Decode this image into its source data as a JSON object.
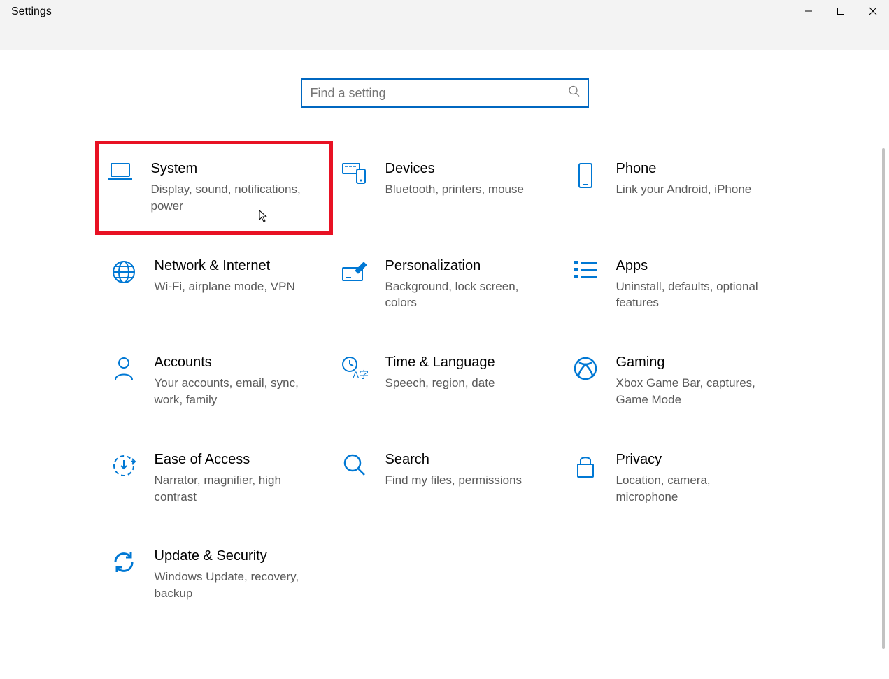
{
  "window": {
    "title": "Settings"
  },
  "search": {
    "placeholder": "Find a setting"
  },
  "tiles": [
    {
      "id": "system",
      "title": "System",
      "desc": "Display, sound, notifications, power",
      "icon": "laptop-icon",
      "highlighted": true
    },
    {
      "id": "devices",
      "title": "Devices",
      "desc": "Bluetooth, printers, mouse",
      "icon": "devices-icon"
    },
    {
      "id": "phone",
      "title": "Phone",
      "desc": "Link your Android, iPhone",
      "icon": "phone-icon"
    },
    {
      "id": "network",
      "title": "Network & Internet",
      "desc": "Wi-Fi, airplane mode, VPN",
      "icon": "globe-icon"
    },
    {
      "id": "personalization",
      "title": "Personalization",
      "desc": "Background, lock screen, colors",
      "icon": "paintbrush-icon"
    },
    {
      "id": "apps",
      "title": "Apps",
      "desc": "Uninstall, defaults, optional features",
      "icon": "list-icon"
    },
    {
      "id": "accounts",
      "title": "Accounts",
      "desc": "Your accounts, email, sync, work, family",
      "icon": "person-icon"
    },
    {
      "id": "time",
      "title": "Time & Language",
      "desc": "Speech, region, date",
      "icon": "clock-language-icon"
    },
    {
      "id": "gaming",
      "title": "Gaming",
      "desc": "Xbox Game Bar, captures, Game Mode",
      "icon": "xbox-icon"
    },
    {
      "id": "ease",
      "title": "Ease of Access",
      "desc": "Narrator, magnifier, high contrast",
      "icon": "ease-icon"
    },
    {
      "id": "search",
      "title": "Search",
      "desc": "Find my files, permissions",
      "icon": "search-icon"
    },
    {
      "id": "privacy",
      "title": "Privacy",
      "desc": "Location, camera, microphone",
      "icon": "lock-icon"
    },
    {
      "id": "update",
      "title": "Update & Security",
      "desc": "Windows Update, recovery, backup",
      "icon": "sync-icon"
    }
  ]
}
